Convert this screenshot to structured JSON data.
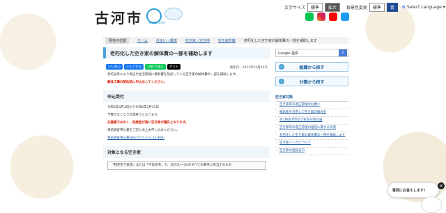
{
  "header": {
    "logo_text": "古河市",
    "logo_sub": "koga city",
    "toolbar": {
      "font_size_label": "文字サイズ",
      "font_normal": "標準",
      "font_large": "拡大",
      "bg_color_label": "背景色変更",
      "bg_normal": "標準",
      "bg_blue": "青",
      "language_label": "Select Language"
    },
    "social": [
      "LINE",
      "Instagram",
      "YouTube",
      "X"
    ]
  },
  "breadcrumb": {
    "here_label": "現在の位置",
    "items": [
      "ホーム",
      "住まい・環境",
      "空き家・空き地",
      "空き家対策",
      "老朽化した空き家の解体費の一部を補助します"
    ]
  },
  "main": {
    "title": "老朽化した空き家の解体費の一部を補助します",
    "share": [
      "いいね 0",
      "シェアする",
      "LINEで送る",
      "ポスト"
    ],
    "updated": "更新日：2023年04月01日",
    "intro": "老朽化等により周辺の生活環境に悪影響を及ぼしている空き家の解体費の一部を補助します。",
    "red_note": "解体工事の契約前に申込みしてください。",
    "section1": "申込受付",
    "period": "令和5年4月3日から令和6年3月31日",
    "budget": "予算がなくなり次第終了となります。",
    "first_come": "先着順ではなく、危険度が高い空き家が優先となります。",
    "consult": "事前調査申込書をご記入の上お申し込みください。",
    "form_link": "事前調査申込書(Wordファイル:23.9KB)",
    "section2": "対象となる空き家",
    "notice": "「特定空き家等」または「不良住宅」で、次の(1)~(3)のすべての要件に該当するもの"
  },
  "sidebar": {
    "search_placeholder": "Google 提供",
    "btn_org": "組織から探す",
    "btn_cat": "分類から探す",
    "list_heading": "空き家対策",
    "items": [
      "空き家等の適正管理のお願い",
      "補助金を活用して空き家の解体を",
      "第2期古河市空き家等対策計画",
      "空き家等の適正管理の推進に関する条例",
      "老朽化した空き家の解体費の一部を補助します",
      "空き家バンクについて",
      "空き家の相談窓口"
    ]
  },
  "chat": {
    "label": "質問にお答えします！"
  }
}
